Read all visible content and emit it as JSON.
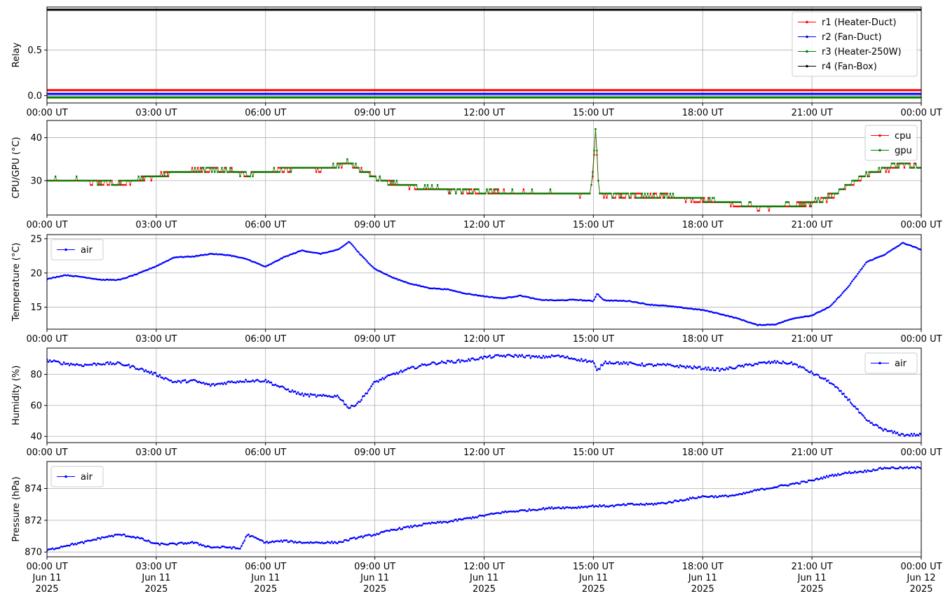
{
  "time_ticks": [
    "00:00 UT",
    "03:00 UT",
    "06:00 UT",
    "09:00 UT",
    "12:00 UT",
    "15:00 UT",
    "18:00 UT",
    "21:00 UT",
    "00:00 UT"
  ],
  "date_lines": [
    "Jun 11",
    "Jun 11",
    "Jun 11",
    "Jun 11",
    "Jun 11",
    "Jun 11",
    "Jun 11",
    "Jun 11",
    "Jun 12"
  ],
  "year_lines": [
    "2025",
    "2025",
    "2025",
    "2025",
    "2025",
    "2025",
    "2025",
    "2025",
    "2025"
  ],
  "chart_data": [
    {
      "type": "line",
      "ylabel": "Relay",
      "ylim": [
        -0.08,
        0.97
      ],
      "yticks": [
        0.0,
        0.5
      ],
      "ytick_labels": [
        "0.0",
        "0.5"
      ],
      "grid": true,
      "legend": "top-right",
      "x_hours": [
        0,
        24
      ],
      "series": [
        {
          "name": "r1 (Heater-Duct)",
          "color": "#ff0000",
          "x": [
            0,
            24
          ],
          "y": [
            0.06,
            0.06
          ]
        },
        {
          "name": "r2 (Fan-Duct)",
          "color": "#0000ff",
          "x": [
            0,
            24
          ],
          "y": [
            0.02,
            0.02
          ]
        },
        {
          "name": "r3 (Heater-250W)",
          "color": "#008000",
          "x": [
            0,
            24
          ],
          "y": [
            -0.02,
            -0.02
          ]
        },
        {
          "name": "r4 (Fan-Box)",
          "color": "#000000",
          "x": [
            0,
            24
          ],
          "y": [
            0.94,
            0.94
          ]
        }
      ]
    },
    {
      "type": "line",
      "ylabel": "CPU/GPU (°C)",
      "ylim": [
        22,
        44
      ],
      "yticks": [
        30,
        40
      ],
      "ytick_labels": [
        "30",
        "40"
      ],
      "grid": true,
      "legend": "top-right",
      "series": [
        {
          "name": "cpu",
          "color": "#ff0000",
          "x": [
            0,
            0.5,
            1,
            1.5,
            2,
            2.5,
            3,
            3.5,
            4,
            4.5,
            5,
            5.5,
            6,
            6.5,
            7,
            7.5,
            8,
            8.3,
            8.5,
            9,
            9.5,
            10,
            10.5,
            11,
            11.5,
            12,
            13,
            14,
            14.9,
            15.0,
            15.05,
            15.1,
            15.15,
            15.3,
            16,
            17,
            18,
            18.5,
            19,
            19.5,
            20,
            20.5,
            21,
            21.5,
            22,
            22.5,
            23,
            23.5,
            24
          ],
          "y": [
            29.8,
            30.2,
            30,
            29.4,
            29.3,
            30.1,
            31,
            31.8,
            32.3,
            32.6,
            32.3,
            31.4,
            32.1,
            32.5,
            33.1,
            32.7,
            33.3,
            34.2,
            33,
            30.5,
            29.2,
            28.6,
            28.1,
            27.8,
            27.5,
            27.2,
            27.1,
            27,
            26.9,
            32,
            43,
            36,
            27.5,
            26.8,
            26.5,
            26.2,
            25.4,
            24.9,
            24.4,
            23.8,
            23.9,
            24.2,
            24.7,
            26.2,
            28.8,
            31.4,
            32.5,
            33.8,
            33
          ]
        },
        {
          "name": "gpu",
          "color": "#008000",
          "x": [
            0,
            0.5,
            1,
            1.5,
            2,
            2.5,
            3,
            3.5,
            4,
            4.5,
            5,
            5.5,
            6,
            6.5,
            7,
            7.5,
            8,
            8.3,
            8.5,
            9,
            9.5,
            10,
            10.5,
            11,
            11.5,
            12,
            13,
            14,
            14.9,
            15.0,
            15.05,
            15.1,
            15.15,
            15.3,
            16,
            17,
            18,
            18.5,
            19,
            19.5,
            20,
            20.5,
            21,
            21.5,
            22,
            22.5,
            23,
            23.5,
            24
          ],
          "y": [
            30,
            30.3,
            30.1,
            29.6,
            29.5,
            30.2,
            31.1,
            32,
            32.4,
            32.7,
            32.4,
            31.5,
            32.2,
            32.6,
            33.2,
            32.8,
            33.4,
            34.4,
            33.1,
            30.6,
            29.4,
            28.8,
            28.2,
            27.9,
            27.6,
            27.3,
            27.3,
            27.1,
            27,
            32.5,
            43.5,
            36.5,
            27.7,
            27,
            26.7,
            26.4,
            25.6,
            25.1,
            24.6,
            24,
            24.1,
            24.4,
            24.9,
            26.4,
            29,
            31.6,
            32.7,
            34,
            33.2
          ]
        }
      ]
    },
    {
      "type": "line",
      "ylabel": "Temperature (°C)",
      "ylim": [
        11.8,
        25.6
      ],
      "yticks": [
        15,
        20,
        25
      ],
      "ytick_labels": [
        "15",
        "20",
        "25"
      ],
      "grid": true,
      "legend": "top-left",
      "series": [
        {
          "name": "air",
          "color": "#0000ff",
          "x": [
            0,
            0.5,
            1,
            1.5,
            2,
            2.5,
            3,
            3.5,
            4,
            4.5,
            5,
            5.5,
            6,
            6.5,
            7,
            7.5,
            8,
            8.3,
            8.6,
            9,
            9.5,
            10,
            10.5,
            11,
            11.5,
            12,
            12.5,
            13,
            13.5,
            14,
            14.5,
            15,
            15.1,
            15.3,
            16,
            16.5,
            17,
            17.5,
            18,
            18.5,
            19,
            19.5,
            20,
            20.5,
            21,
            21.5,
            22,
            22.5,
            23,
            23.5,
            24
          ],
          "y": [
            19.1,
            19.7,
            19.4,
            19.0,
            19.0,
            19.9,
            21.0,
            22.3,
            22.4,
            22.8,
            22.6,
            22.0,
            20.9,
            22.3,
            23.3,
            22.8,
            23.4,
            24.6,
            22.7,
            20.6,
            19.3,
            18.4,
            17.8,
            17.6,
            17.0,
            16.6,
            16.3,
            16.7,
            16.1,
            16.0,
            16.1,
            15.9,
            17.0,
            16.0,
            15.9,
            15.4,
            15.2,
            14.9,
            14.6,
            14.0,
            13.3,
            12.4,
            12.5,
            13.4,
            13.8,
            15.1,
            18.0,
            21.6,
            22.7,
            24.4,
            23.4
          ]
        }
      ]
    },
    {
      "type": "line",
      "ylabel": "Humidity (%)",
      "ylim": [
        36,
        97
      ],
      "yticks": [
        40,
        60,
        80
      ],
      "ytick_labels": [
        "40",
        "60",
        "80"
      ],
      "grid": true,
      "legend": "top-right",
      "series": [
        {
          "name": "air",
          "color": "#0000ff",
          "x": [
            0,
            0.5,
            1,
            1.5,
            2,
            2.5,
            3,
            3.5,
            4,
            4.5,
            5,
            5.5,
            6,
            6.5,
            7,
            7.5,
            8,
            8.3,
            8.6,
            9,
            9.5,
            10,
            10.5,
            11,
            11.5,
            12,
            12.5,
            13,
            13.5,
            14,
            14.5,
            15,
            15.1,
            15.3,
            16,
            16.5,
            17,
            17.5,
            18,
            18.5,
            19,
            19.5,
            20,
            20.5,
            21,
            21.5,
            22,
            22.5,
            23,
            23.5,
            24
          ],
          "y": [
            89,
            87,
            86,
            87,
            87,
            84,
            80,
            75,
            76,
            73,
            75,
            76,
            76,
            71,
            67,
            66,
            66,
            58,
            63,
            75,
            80,
            84,
            87,
            88,
            89,
            91,
            92,
            92,
            91,
            92,
            90,
            88,
            82,
            88,
            87,
            86,
            86,
            85,
            84,
            83,
            85,
            87,
            88,
            87,
            81,
            75,
            64,
            50,
            44,
            41,
            41
          ]
        }
      ]
    },
    {
      "type": "line",
      "ylabel": "Pressure (hPa)",
      "ylim": [
        869.7,
        875.7
      ],
      "yticks": [
        870,
        872,
        874
      ],
      "ytick_labels": [
        "870",
        "872",
        "874"
      ],
      "grid": true,
      "legend": "top-left",
      "series": [
        {
          "name": "air",
          "color": "#0000ff",
          "x": [
            0,
            0.5,
            1,
            1.5,
            2,
            2.5,
            3,
            3.5,
            4,
            4.5,
            5,
            5.3,
            5.5,
            6,
            6.5,
            7,
            7.5,
            8,
            8.5,
            9,
            9.5,
            10,
            10.5,
            11,
            11.5,
            12,
            12.5,
            13,
            13.5,
            14,
            14.5,
            15,
            15.5,
            16,
            16.5,
            17,
            17.5,
            18,
            18.5,
            19,
            19.5,
            20,
            20.5,
            21,
            21.5,
            22,
            22.5,
            23,
            23.5,
            24
          ],
          "y": [
            870.1,
            870.4,
            870.6,
            870.9,
            871.1,
            870.9,
            870.5,
            870.5,
            870.6,
            870.3,
            870.3,
            870.2,
            871.1,
            870.6,
            870.7,
            870.6,
            870.6,
            870.6,
            870.9,
            871.1,
            871.4,
            871.6,
            871.8,
            871.9,
            872.1,
            872.3,
            872.5,
            872.6,
            872.7,
            872.8,
            872.8,
            872.9,
            872.9,
            873.0,
            873.0,
            873.1,
            873.3,
            873.5,
            873.5,
            873.6,
            873.9,
            874.1,
            874.3,
            874.5,
            874.8,
            875.0,
            875.1,
            875.3,
            875.3,
            875.3
          ]
        }
      ]
    }
  ]
}
